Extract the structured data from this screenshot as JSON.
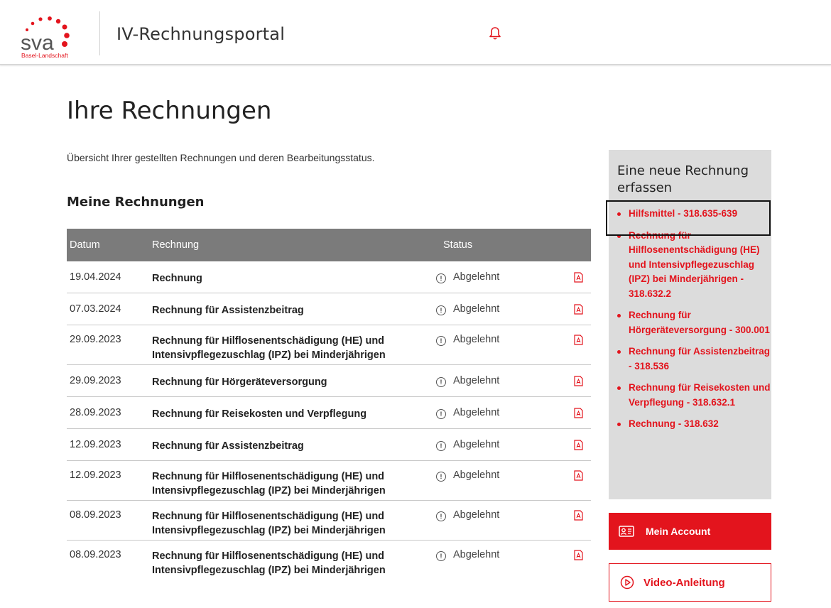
{
  "header": {
    "logo_text": "sva",
    "logo_subtext": "Basel-Landschaft",
    "app_title": "IV-Rechnungsportal",
    "notification_icon": "bell-icon"
  },
  "main": {
    "page_title": "Ihre Rechnungen",
    "intro": "Übersicht Ihrer gestellten Rechnungen und deren Bearbeitungsstatus.",
    "section_title": "Meine Rechnungen",
    "table": {
      "columns": [
        "Datum",
        "Rechnung",
        "Status"
      ],
      "rows": [
        {
          "date": "19.04.2024",
          "invoice": "Rechnung",
          "status": "Abgelehnt"
        },
        {
          "date": "07.03.2024",
          "invoice": "Rechnung für Assistenzbeitrag",
          "status": "Abgelehnt"
        },
        {
          "date": "29.09.2023",
          "invoice": "Rechnung für Hilflosenentschädigung (HE) und Intensivpflegezuschlag (IPZ) bei Minderjährigen",
          "status": "Abgelehnt"
        },
        {
          "date": "29.09.2023",
          "invoice": "Rechnung für Hörgeräteversorgung",
          "status": "Abgelehnt"
        },
        {
          "date": "28.09.2023",
          "invoice": "Rechnung für Reisekosten und Verpflegung",
          "status": "Abgelehnt"
        },
        {
          "date": "12.09.2023",
          "invoice": "Rechnung für Assistenzbeitrag",
          "status": "Abgelehnt"
        },
        {
          "date": "12.09.2023",
          "invoice": "Rechnung für Hilflosenentschädigung (HE) und Intensivpflegezuschlag (IPZ) bei Minderjährigen",
          "status": "Abgelehnt"
        },
        {
          "date": "08.09.2023",
          "invoice": "Rechnung für Hilflosenentschädigung (HE) und Intensivpflegezuschlag (IPZ) bei Minderjährigen",
          "status": "Abgelehnt"
        },
        {
          "date": "08.09.2023",
          "invoice": "Rechnung für Hilflosenentschädigung (HE) und Intensivpflegezuschlag (IPZ) bei Minderjährigen",
          "status": "Abgelehnt"
        }
      ]
    }
  },
  "sidebar": {
    "title": "Eine neue Rechnung erfassen",
    "links": [
      "Hilfsmittel - 318.635-639",
      "Rechnung für Hilflosenentschädigung (HE) und Intensivpflegezuschlag (IPZ) bei Minderjährigen - 318.632.2",
      "Rechnung für Hörgeräteversorgung - 300.001",
      "Rechnung für Assistenzbeitrag - 318.536",
      "Rechnung für Reisekosten und Verpflegung - 318.632.1",
      "Rechnung - 318.632"
    ],
    "account_button": "Mein Account",
    "video_button": "Video-Anleitung"
  },
  "colors": {
    "brand_red": "#e3141d",
    "table_header": "#7b7b7b",
    "sidebar_bg": "#dcdcdc"
  }
}
